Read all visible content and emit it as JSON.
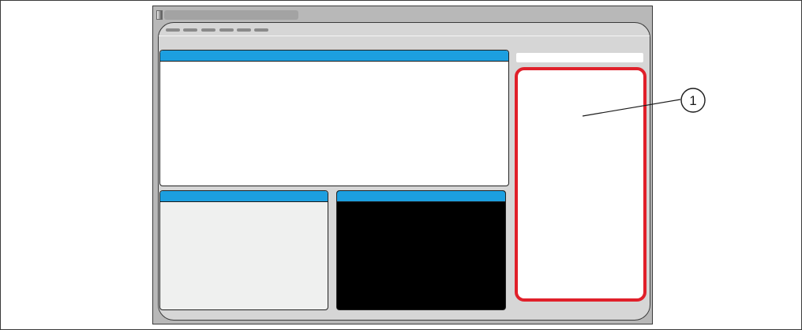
{
  "diagram": {
    "callouts": [
      {
        "number": "1",
        "target": "side-panel"
      }
    ],
    "colors": {
      "pane_header": "#1c9fe0",
      "highlight_outline": "#e0202a",
      "bezel": "#b8b8b8",
      "window_background": "#d6d6d6",
      "video_pane": "#000000"
    },
    "icons": [
      "title-grip-icon",
      "callout-circle-icon"
    ]
  }
}
